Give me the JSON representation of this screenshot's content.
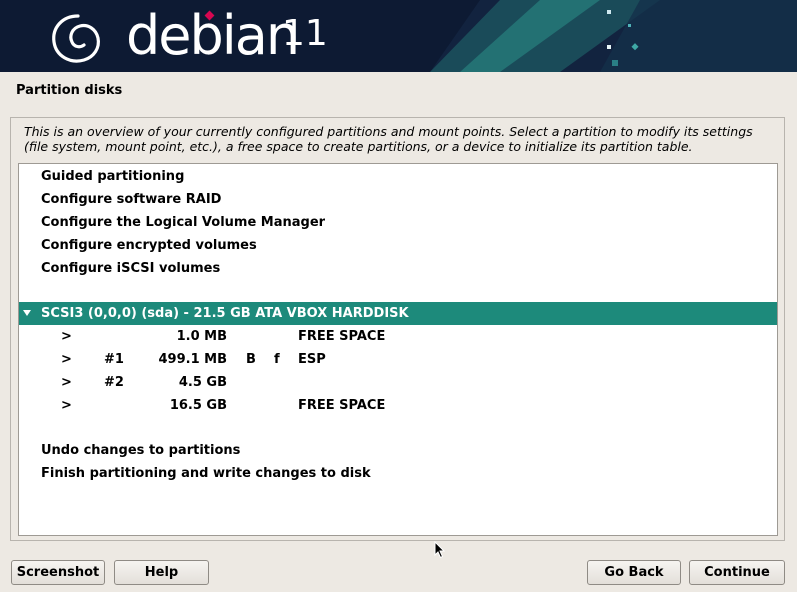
{
  "header": {
    "brand": "debian",
    "version": "11"
  },
  "step_title": "Partition disks",
  "help_text": "This is an overview of your currently configured partitions and mount points. Select a partition to modify its settings (file system, mount point, etc.), a free space to create partitions, or a device to initialize its partition table.",
  "menu_top": [
    {
      "label": "Guided partitioning"
    },
    {
      "label": "Configure software RAID"
    },
    {
      "label": "Configure the Logical Volume Manager"
    },
    {
      "label": "Configure encrypted volumes"
    },
    {
      "label": "Configure iSCSI volumes"
    }
  ],
  "disk": {
    "label": "SCSI3 (0,0,0) (sda) - 21.5 GB ATA VBOX HARDDISK",
    "selected": true
  },
  "partitions": [
    {
      "arrow": ">",
      "num": "",
      "size": "1.0 MB",
      "flag_b": "",
      "flag_f": "",
      "desc": "FREE SPACE"
    },
    {
      "arrow": ">",
      "num": "#1",
      "size": "499.1 MB",
      "flag_b": "B",
      "flag_f": "f",
      "desc": "ESP"
    },
    {
      "arrow": ">",
      "num": "#2",
      "size": "4.5 GB",
      "flag_b": "",
      "flag_f": "",
      "desc": ""
    },
    {
      "arrow": ">",
      "num": "",
      "size": "16.5 GB",
      "flag_b": "",
      "flag_f": "",
      "desc": "FREE SPACE"
    }
  ],
  "menu_bottom": [
    {
      "label": "Undo changes to partitions"
    },
    {
      "label": "Finish partitioning and write changes to disk"
    }
  ],
  "buttons": {
    "screenshot": "Screenshot",
    "help": "Help",
    "go_back": "Go Back",
    "continue": "Continue"
  },
  "colors": {
    "banner_bg": "#0d1a33",
    "selection": "#1d8a7b",
    "background": "#ede9e3"
  }
}
